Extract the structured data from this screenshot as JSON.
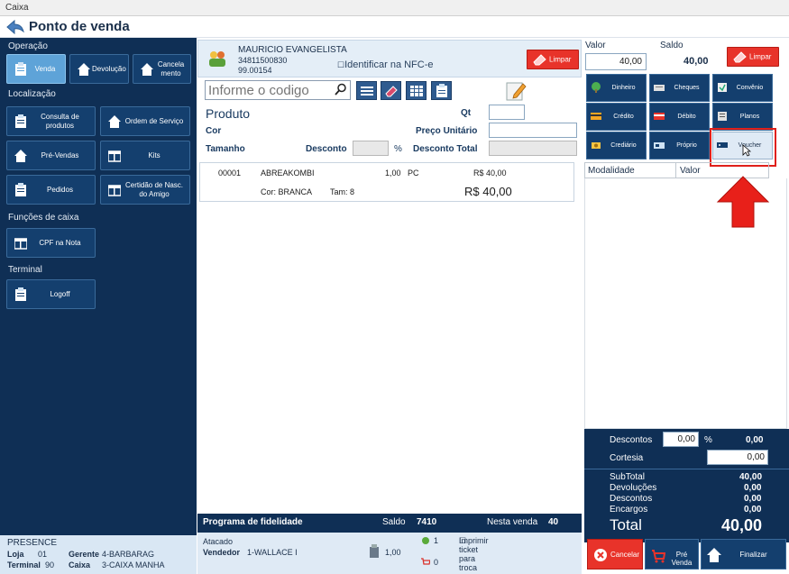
{
  "window": {
    "title": "Caixa"
  },
  "header": {
    "title": "Ponto de venda"
  },
  "sidebar": {
    "operacao_label": "Operação",
    "operacao": [
      {
        "label": "Venda",
        "icon": "clipboard-icon",
        "active": true
      },
      {
        "label": "Devolução",
        "icon": "home-icon",
        "active": false
      },
      {
        "label": "Cancela mento",
        "icon": "home-icon",
        "active": false
      }
    ],
    "localizacao_label": "Localização",
    "localizacao": [
      {
        "label": "Consulta de produtos",
        "icon": "clipboard-icon"
      },
      {
        "label": "Ordem de Serviço",
        "icon": "home-icon"
      },
      {
        "label": "Pré-Vendas",
        "icon": "home-icon"
      },
      {
        "label": "Kits",
        "icon": "window-icon"
      },
      {
        "label": "Pedidos",
        "icon": "clipboard-icon"
      },
      {
        "label": "Certidão de Nasc. do Amigo",
        "icon": "window-icon"
      }
    ],
    "funcoes_label": "Funções de caixa",
    "funcoes": [
      {
        "label": "CPF na Nota",
        "icon": "window-icon"
      }
    ],
    "terminal_label": "Terminal",
    "terminal": [
      {
        "label": "Logoff",
        "icon": "clipboard-icon"
      }
    ],
    "footer": {
      "company": "PRESENCE",
      "loja_label": "Loja",
      "loja_value": "01",
      "gerente_label": "Gerente",
      "gerente_value": "4-BARBARAG",
      "terminal_label": "Terminal",
      "terminal_value": "90",
      "caixa_label": "Caixa",
      "caixa_value": "3-CAIXA MANHA"
    }
  },
  "customer": {
    "name": "MAURICIO EVANGELISTA",
    "phone": "34811500830",
    "code": "99.00154",
    "nfce_label": "Identificar na NFC-e",
    "limpar_label": "Limpar"
  },
  "product_form": {
    "code_placeholder": "Informe o codigo",
    "produto_label": "Produto",
    "qt_label": "Qt",
    "cor_label": "Cor",
    "preco_label": "Preço Unitário",
    "tamanho_label": "Tamanho",
    "desconto_label": "Desconto",
    "percent_label": "%",
    "desconto_total_label": "Desconto Total"
  },
  "items": [
    {
      "code": "00001",
      "description": "ABREAKOMBI",
      "qty": "1,00",
      "unit": "PC",
      "price": "R$ 40,00",
      "color": "Cor: BRANCA",
      "size": "Tam: 8",
      "total": "R$ 40,00"
    }
  ],
  "fidelidade": {
    "label": "Programa de fidelidade",
    "saldo_label": "Saldo",
    "saldo_value": "7410",
    "nesta_venda_label": "Nesta venda",
    "nesta_venda_value": "40"
  },
  "sale_info": {
    "tipo": "Atacado",
    "vendedor_label": "Vendedor",
    "vendedor_value": "1-WALLACE I",
    "volume_value": "1,00",
    "green_count": "1",
    "cart_count": "0",
    "imprimir_label": "Imprimir ticket para troca"
  },
  "payment": {
    "valor_label": "Valor",
    "valor_value": "40,00",
    "saldo_label": "Saldo",
    "saldo_value": "40,00",
    "limpar_label": "Limpar",
    "methods": [
      {
        "label": "Dinheiro",
        "icon": "cash-tree-icon"
      },
      {
        "label": "Cheques",
        "icon": "cheque-icon"
      },
      {
        "label": "Convênio",
        "icon": "agreement-icon"
      },
      {
        "label": "Crédito",
        "icon": "credit-card-icon"
      },
      {
        "label": "Débito",
        "icon": "debit-card-icon"
      },
      {
        "label": "Planos",
        "icon": "plans-icon"
      },
      {
        "label": "Crediário",
        "icon": "installment-icon"
      },
      {
        "label": "Próprio",
        "icon": "own-card-icon"
      },
      {
        "label": "Voucher",
        "icon": "voucher-icon"
      }
    ],
    "table_headers": [
      "Modalidade",
      "Valor"
    ]
  },
  "totals": {
    "descontos_label": "Descontos",
    "descontos_input": "0,00",
    "descontos_pct": "%",
    "descontos_value": "0,00",
    "cortesia_label": "Cortesia",
    "cortesia_value": "0,00",
    "subtotal_label": "SubTotal",
    "subtotal_value": "40,00",
    "devolucoes_label": "Devoluções",
    "devolucoes_value": "0,00",
    "descontos2_label": "Descontos",
    "descontos2_value": "0,00",
    "encargos_label": "Encargos",
    "encargos_value": "0,00",
    "total_label": "Total",
    "total_value": "40,00"
  },
  "actions": {
    "cancelar": "Cancelar",
    "pre_venda": "Pré Venda",
    "finalizar": "Finalizar"
  },
  "colors": {
    "navy": "#0f2f55",
    "button": "#143f6e",
    "active": "#5ea3d8",
    "red": "#e8332a"
  }
}
